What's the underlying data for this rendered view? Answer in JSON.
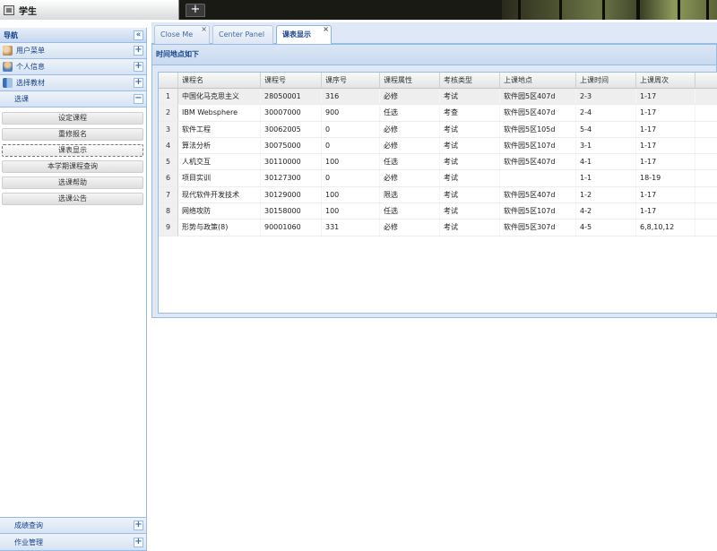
{
  "app": {
    "title": "学生"
  },
  "nav": {
    "title": "导航",
    "collapse_symbol": "«",
    "sections": [
      {
        "label": "用户菜单",
        "icon": "user-group-icon",
        "toggle": "+"
      },
      {
        "label": "个人信息",
        "icon": "person-icon",
        "toggle": "+"
      },
      {
        "label": "选择教材",
        "icon": "book-icon",
        "toggle": "+"
      },
      {
        "label": "选课",
        "icon": "",
        "toggle": "−"
      }
    ],
    "menu_items": [
      "设定课程",
      "重修报名",
      "课表显示",
      "本学期课程查询",
      "选课帮助",
      "选课公告"
    ],
    "active_menu_index": 2,
    "bottom_sections": [
      {
        "label": "成绩查询",
        "toggle": "+"
      },
      {
        "label": "作业管理",
        "toggle": "+"
      }
    ]
  },
  "tabs": {
    "items": [
      {
        "label": "Close Me",
        "closable": true,
        "active": false
      },
      {
        "label": "Center Panel",
        "closable": false,
        "active": false
      },
      {
        "label": "课表显示",
        "closable": true,
        "active": true
      }
    ],
    "close_symbol": "×",
    "add_symbol": "+"
  },
  "panel": {
    "title": "时间地点如下",
    "columns": [
      "课程名",
      "课程号",
      "课序号",
      "课程属性",
      "考核类型",
      "上课地点",
      "上课时间",
      "上课周次"
    ],
    "rows": [
      {
        "num": "1",
        "cells": [
          "中国化马克思主义",
          "28050001",
          "316",
          "必修",
          "考试",
          "软件园5区407d",
          "2-3",
          "1-17"
        ]
      },
      {
        "num": "2",
        "cells": [
          "IBM Websphere",
          "30007000",
          "900",
          "任选",
          "考查",
          "软件园5区407d",
          "2-4",
          "1-17"
        ]
      },
      {
        "num": "3",
        "cells": [
          "软件工程",
          "30062005",
          "0",
          "必修",
          "考试",
          "软件园5区105d",
          "5-4",
          "1-17"
        ]
      },
      {
        "num": "4",
        "cells": [
          "算法分析",
          "30075000",
          "0",
          "必修",
          "考试",
          "软件园5区107d",
          "3-1",
          "1-17"
        ]
      },
      {
        "num": "5",
        "cells": [
          "人机交互",
          "30110000",
          "100",
          "任选",
          "考试",
          "软件园5区407d",
          "4-1",
          "1-17"
        ]
      },
      {
        "num": "6",
        "cells": [
          "项目实训",
          "30127300",
          "0",
          "必修",
          "考试",
          "",
          "1-1",
          "18-19"
        ]
      },
      {
        "num": "7",
        "cells": [
          "现代软件开发技术",
          "30129000",
          "100",
          "限选",
          "考试",
          "软件园5区407d",
          "1-2",
          "1-17"
        ]
      },
      {
        "num": "8",
        "cells": [
          "网络攻防",
          "30158000",
          "100",
          "任选",
          "考试",
          "软件园5区107d",
          "4-2",
          "1-17"
        ]
      },
      {
        "num": "9",
        "cells": [
          "形势与政策(8)",
          "90001060",
          "331",
          "必修",
          "考试",
          "软件园5区307d",
          "4-5",
          "6,8,10,12"
        ]
      }
    ],
    "selected_row_index": 0
  },
  "colors": {
    "header_text": "#15428b",
    "border": "#99bbe8",
    "panel_bg": "#dfe8f6"
  }
}
